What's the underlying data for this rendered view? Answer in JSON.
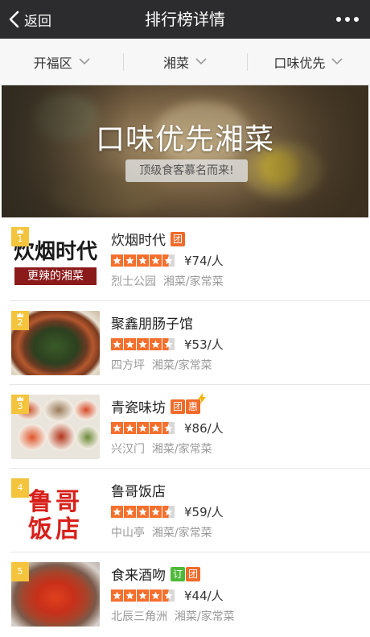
{
  "nav": {
    "back_label": "返回",
    "title": "排行榜详情"
  },
  "filters": [
    {
      "label": "开福区"
    },
    {
      "label": "湘菜"
    },
    {
      "label": "口味优先"
    }
  ],
  "banner": {
    "title": "口味优先湘菜",
    "tag": "顶级食客慕名而来!"
  },
  "restaurants": [
    {
      "rank": "1",
      "name": "炊烟时代",
      "badges": [
        "团"
      ],
      "price": "¥74/人",
      "area": "烈士公园",
      "category": "湘菜/家常菜",
      "rating_stars": 4.5,
      "thumb_text": {
        "line1": "炊烟时代",
        "line2": "更辣的湘菜"
      }
    },
    {
      "rank": "2",
      "name": "聚鑫朋肠子馆",
      "badges": [],
      "price": "¥53/人",
      "area": "四方坪",
      "category": "湘菜/家常菜",
      "rating_stars": 4.5
    },
    {
      "rank": "3",
      "name": "青瓷味坊",
      "badges": [
        "团",
        "惠"
      ],
      "price": "¥86/人",
      "area": "兴汉门",
      "category": "湘菜/家常菜",
      "rating_stars": 4.5
    },
    {
      "rank": "4",
      "name": "鲁哥饭店",
      "badges": [],
      "price": "¥59/人",
      "area": "中山亭",
      "category": "湘菜/家常菜",
      "rating_stars": 4.5,
      "thumb_text": {
        "line1": "鲁哥",
        "line2": "饭店"
      }
    },
    {
      "rank": "5",
      "name": "食来酒吻",
      "badges": [
        "订",
        "团"
      ],
      "price": "¥44/人",
      "area": "北辰三角洲",
      "category": "湘菜/家常菜",
      "rating_stars": 4.5
    }
  ],
  "colors": {
    "navbar": "#2c2c2e",
    "star": "#f56f2d",
    "badge_tuan": "#f06a2a",
    "badge_ding": "#4fb93a",
    "rank_badge": "#f3c43c"
  }
}
